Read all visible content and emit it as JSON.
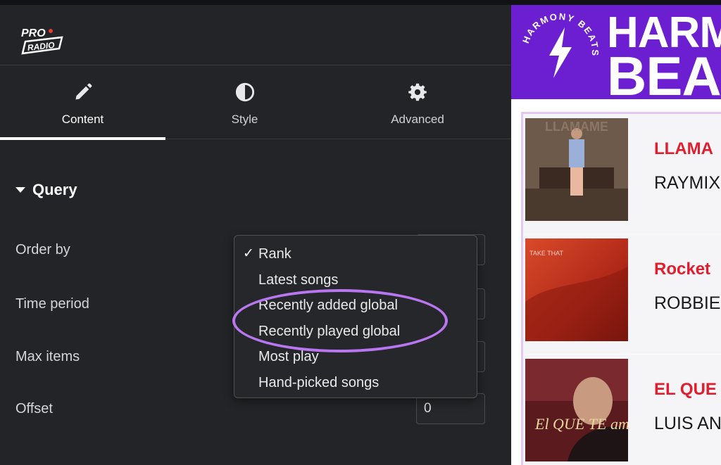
{
  "brand": {
    "logo_top": "PRO",
    "logo_bottom": "RADIO"
  },
  "tabs": [
    {
      "label": "Content",
      "icon": "pencil-icon",
      "active": true
    },
    {
      "label": "Style",
      "icon": "contrast-icon",
      "active": false
    },
    {
      "label": "Advanced",
      "icon": "gear-icon",
      "active": false
    }
  ],
  "section": {
    "title": "Query"
  },
  "fields": {
    "order_by": {
      "label": "Order by"
    },
    "time_period": {
      "label": "Time period"
    },
    "max_items": {
      "label": "Max items"
    },
    "offset": {
      "label": "Offset",
      "value": "0"
    }
  },
  "dropdown": {
    "selected": "Rank",
    "options": [
      "Rank",
      "Latest songs",
      "Recently added global",
      "Recently played global",
      "Most play",
      "Hand-picked songs"
    ]
  },
  "preview": {
    "badge_text": "HARMONY BEATS",
    "banner_line1": "HARM",
    "banner_line2": "BEA",
    "banner_color": "#6c1ed1",
    "title_color": "#e01e2e",
    "items": [
      {
        "title": "LLAMA",
        "artist": "RAYMIX",
        "thumb_text": "LLAMAME"
      },
      {
        "title": "Rocket",
        "artist": "ROBBIE",
        "thumb_text": "TAKE THAT"
      },
      {
        "title": "EL QUE T",
        "artist": "LUIS AN",
        "thumb_text": "El QUE TE amó"
      }
    ]
  },
  "highlight_color": "#b877f0"
}
